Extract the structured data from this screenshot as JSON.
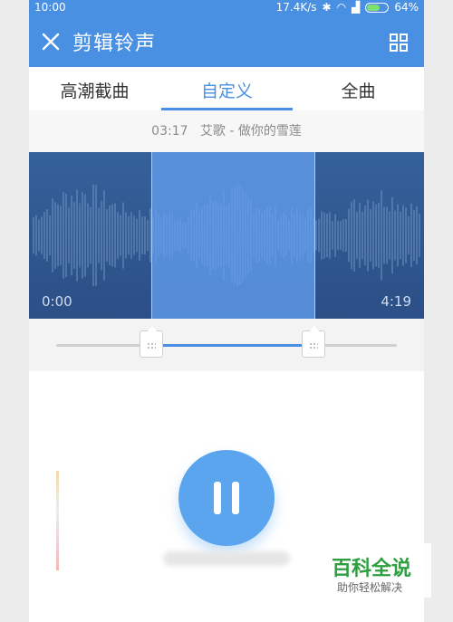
{
  "status_bar": {
    "time": "10:00",
    "network_speed": "17.4K/s",
    "battery": "64%",
    "battery_level": 0.64
  },
  "app_bar": {
    "title": "剪辑铃声",
    "close_icon": "close-icon",
    "menu_icon": "grid-icon"
  },
  "tabs": [
    {
      "label": "高潮截曲",
      "active": false
    },
    {
      "label": "自定义",
      "active": true
    },
    {
      "label": "全曲",
      "active": false
    }
  ],
  "song": {
    "duration_label": "03:17",
    "title": "艾歌 - 做你的雪莲"
  },
  "waveform": {
    "start_time": "0:00",
    "end_time": "4:19",
    "selection_start_fraction": 0.31,
    "selection_end_fraction": 0.72
  },
  "player": {
    "state": "playing",
    "button_icon": "pause-icon"
  },
  "watermark": {
    "main": "百科全说",
    "sub": "助你轻松解决"
  },
  "colors": {
    "accent": "#4a90e2",
    "waveform_bg": "#2f5890",
    "selection": "#64a0f0",
    "play_button": "#5aa5ee",
    "watermark_green": "#2e9e3f"
  }
}
